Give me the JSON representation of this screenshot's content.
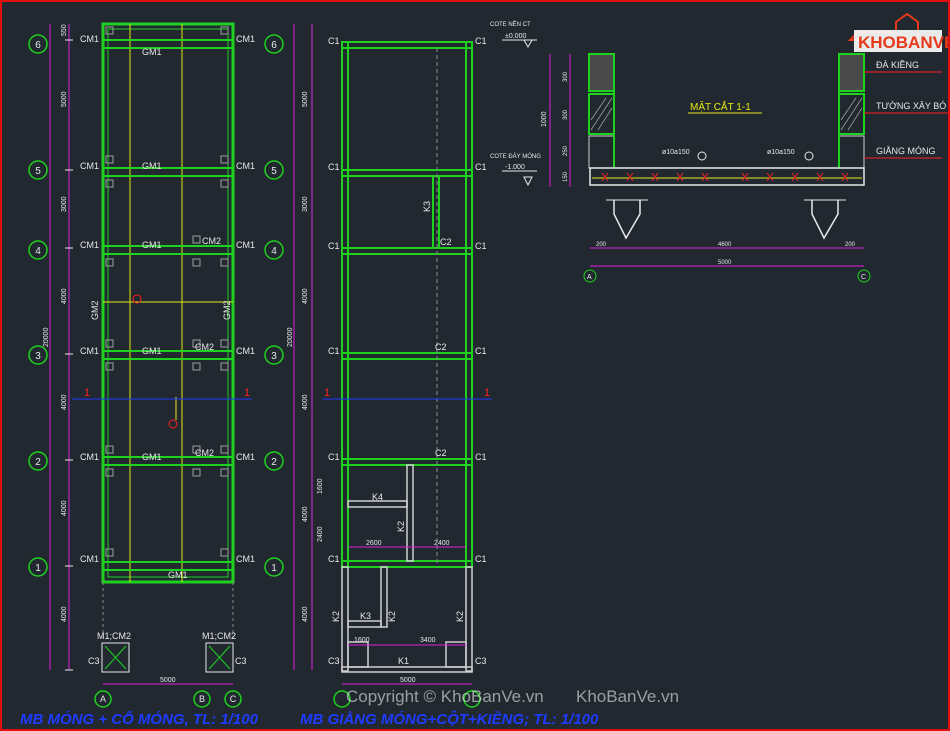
{
  "plan1": {
    "title": "MB MÓNG + CỔ MÓNG, TL: 1/100",
    "axes_rows": [
      "6",
      "5",
      "4",
      "3",
      "2",
      "1"
    ],
    "axes_cols": [
      "A",
      "B",
      "C"
    ],
    "row_dims": [
      "5000",
      "3000",
      "4000",
      "4000",
      "4000",
      "4000"
    ],
    "top_dim": "550",
    "total_dim": "20000",
    "bottom_dim": "5000",
    "cm1": "CM1",
    "cm2": "CM2",
    "gm1": "GM1",
    "gm2": "GM2",
    "m1cm2": "M1;CM2",
    "c3": "C3",
    "cut": "1"
  },
  "plan2": {
    "title": "MB GIẰNG MÓNG+CỘT+KIỀNG; TL: 1/100",
    "axes_rows": [
      "6",
      "5",
      "4",
      "3",
      "2",
      "1"
    ],
    "row_dims": [
      "5000",
      "3000",
      "4000",
      "4000",
      "4000",
      "4000"
    ],
    "total_dim": "20000",
    "c1": "C1",
    "c2": "C2",
    "c3": "C3",
    "k1": "K1",
    "k2": "K2",
    "k3": "K3",
    "k4": "K4",
    "d1600": "1600",
    "d2400": "2400",
    "d2600": "2600",
    "d2400b": "2400",
    "d1600b": "1600",
    "d3400": "3400",
    "bottom_dim": "5000",
    "cut": "1"
  },
  "section": {
    "title": "MẶT CẮT 1-1",
    "cote_nen": "COTE NỀN CT",
    "cote_nen_val": "±0.000",
    "cote_day": "COTE ĐÁY MÓNG",
    "cote_day_val": "-1.000",
    "h_dims": [
      "300",
      "300",
      "250",
      "150"
    ],
    "h_total": "1000",
    "rebar_left": "ø10a150",
    "rebar_right": "ø10a150",
    "label_da_kieng": "ĐÀ KIỀNG",
    "label_tuong": "TƯỜNG XÂY BÓ",
    "label_giang": "GIẰNG MÓNG",
    "w_left": "200",
    "w_mid": "4600",
    "w_right": "200",
    "w_total": "5000",
    "axis_a": "A",
    "axis_c": "C"
  },
  "logo": {
    "text": "KHOBANVE"
  },
  "watermark": {
    "text": "Copyright © KhoBanVe.vn",
    "text2": "KhoBanVe.vn"
  },
  "colors": {
    "green": "#1fd11f",
    "yellow": "#e8e814",
    "magenta": "#e020e0",
    "red": "#ff2020",
    "blue": "#1f3bff",
    "white": "#e8e8e8"
  }
}
